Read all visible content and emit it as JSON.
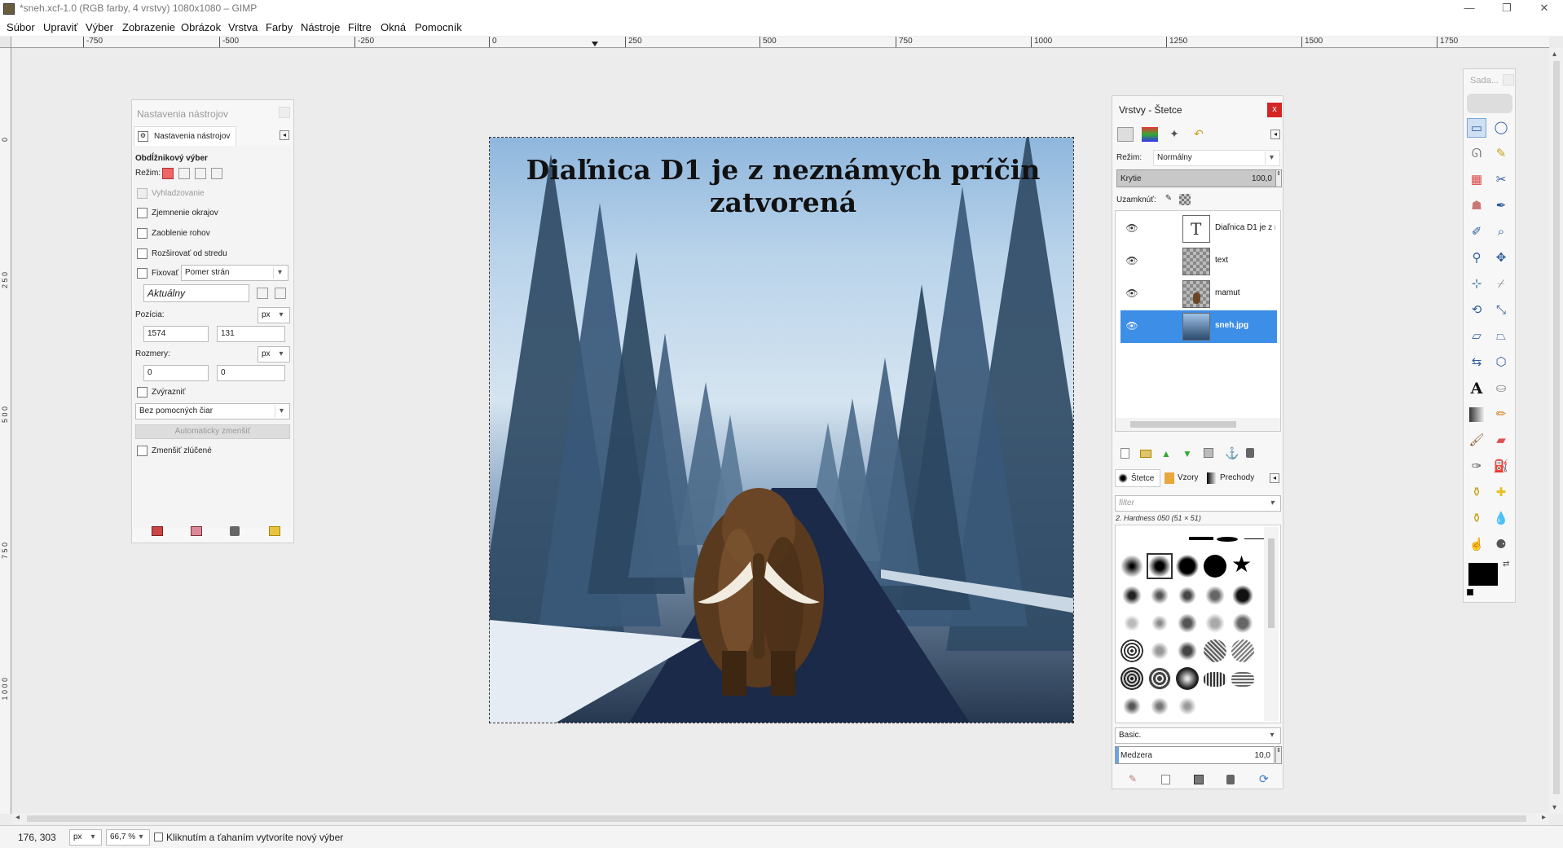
{
  "window": {
    "title": "*sneh.xcf-1.0 (RGB farby, 4 vrstvy) 1080x1080 – GIMP",
    "minimize": "—",
    "maximize": "❐",
    "close": "✕"
  },
  "menu": [
    "Súbor",
    "Upraviť",
    "Výber",
    "Zobrazenie",
    "Obrázok",
    "Vrstva",
    "Farby",
    "Nástroje",
    "Filtre",
    "Okná",
    "Pomocník"
  ],
  "ruler": {
    "h_labels": [
      "-750",
      "-500",
      "-250",
      "0",
      "250",
      "500",
      "750",
      "1000",
      "1250",
      "1500",
      "1750"
    ],
    "v_labels": [
      "0",
      "2 5 0",
      "5 0 0",
      "7 5 0",
      "1 0 0 0"
    ]
  },
  "image": {
    "headline": "Diaľnica D1 je z neznámych príčin zatvorená"
  },
  "tool_options": {
    "dock_title": "Nastavenia nástrojov",
    "tab_label": "Nastavenia nástrojov",
    "tool_name": "Obdĺžnikový výber",
    "mode_label": "Režim:",
    "antialias": "Vyhladzovanie",
    "feather": "Zjemnenie okrajov",
    "rounded": "Zaoblenie rohov",
    "expand": "Rozširovať od stredu",
    "fixed": "Fixovať",
    "fixed_option": "Pomer strán",
    "current": "Aktuálny",
    "position_label": "Pozícia:",
    "position_unit": "px",
    "pos_x": "1574",
    "pos_y": "131",
    "size_label": "Rozmery:",
    "size_unit": "px",
    "size_w": "0",
    "size_h": "0",
    "highlight": "Zvýrazniť",
    "guides": "Bez pomocných čiar",
    "autoshrink": "Automaticky zmenšiť",
    "shrink_merged": "Zmenšiť zlúčené"
  },
  "layers": {
    "dock_title": "Vrstvy - Štetce",
    "close": "x",
    "mode_label": "Režim:",
    "mode_value": "Normálny",
    "opacity_label": "Krytie",
    "opacity_value": "100,0",
    "lock_label": "Uzamknúť:",
    "items": [
      {
        "name": "Diaľnica D1 je z nez",
        "selected": false
      },
      {
        "name": "text",
        "selected": false
      },
      {
        "name": "mamut",
        "selected": false
      },
      {
        "name": "sneh.jpg",
        "selected": true
      }
    ],
    "selected_color": "#3d8ee6"
  },
  "brushes": {
    "tabs": [
      "Štetce",
      "Vzory",
      "Prechody"
    ],
    "filter_placeholder": "filter",
    "current_brush": "2. Hardness 050 (51 × 51)",
    "preset": "Basic.",
    "spacing_label": "Medzera",
    "spacing_value": "10,0"
  },
  "toolbox": {
    "title": "Sada..."
  },
  "status": {
    "coords": "176, 303",
    "unit": "px",
    "zoom": "66,7 %",
    "message": "Kliknutím a ťahaním vytvoríte nový výber"
  }
}
